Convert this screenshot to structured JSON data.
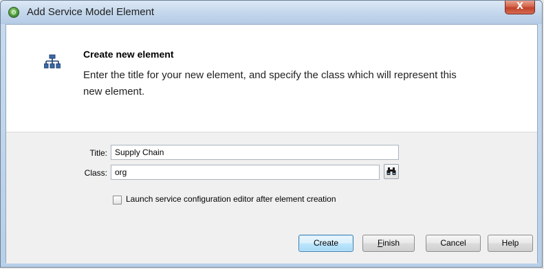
{
  "window": {
    "title": "Add Service Model Element",
    "close_glyph": "X"
  },
  "header": {
    "icon": "hierarchy-icon",
    "title": "Create new element",
    "description": "Enter the title for your new element, and specify the class which will represent this new element."
  },
  "form": {
    "title_label": "Title:",
    "title_value": "Supply Chain",
    "class_label": "Class:",
    "class_value": "org",
    "browse_icon": "binoculars-icon",
    "launch_checkbox_label": "Launch service configuration editor after element creation",
    "launch_checked": false
  },
  "buttons": {
    "create": "Create",
    "finish_first": "F",
    "finish_rest": "inish",
    "cancel": "Cancel",
    "help": "Help"
  },
  "colors": {
    "default_button_border": "#3c7fb1",
    "titlebar": "#c3d6ec",
    "close_button": "#c2412a"
  }
}
